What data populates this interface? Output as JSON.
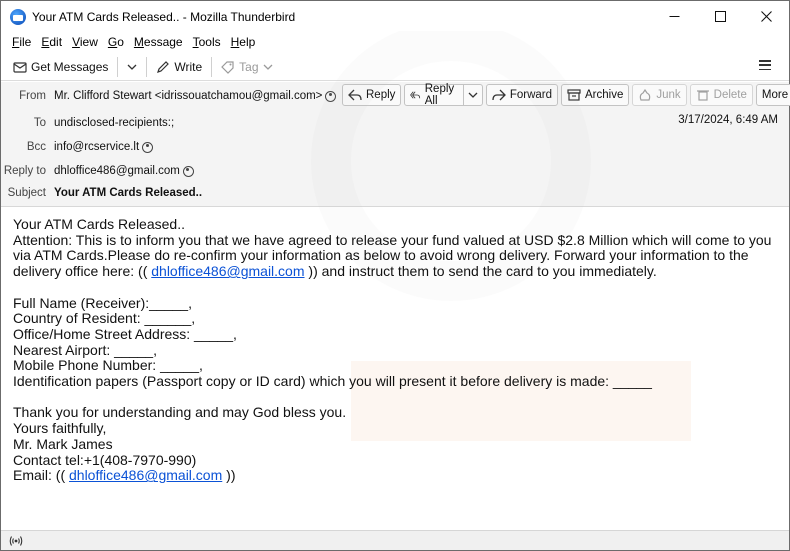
{
  "window": {
    "title": "Your ATM Cards Released.. - Mozilla Thunderbird",
    "controls": [
      "minimize",
      "maximize",
      "close"
    ]
  },
  "menu": [
    "File",
    "Edit",
    "View",
    "Go",
    "Message",
    "Tools",
    "Help"
  ],
  "toolbar": {
    "get_messages": "Get Messages",
    "write": "Write",
    "tag": "Tag"
  },
  "header": {
    "from_label": "From",
    "from_value": "Mr. Clifford Stewart <idrissouatchamou@gmail.com>",
    "to_label": "To",
    "to_value": "undisclosed-recipients:;",
    "bcc_label": "Bcc",
    "bcc_value": "info@rcservice.lt",
    "reply_to_label": "Reply to",
    "reply_to_value": "dhloffice486@gmail.com",
    "subject_label": "Subject",
    "subject_value": "Your ATM Cards Released..",
    "date": "3/17/2024, 6:49 AM",
    "actions": {
      "reply": "Reply",
      "reply_all": "Reply All",
      "forward": "Forward",
      "archive": "Archive",
      "junk": "Junk",
      "delete": "Delete",
      "more": "More"
    }
  },
  "body": {
    "subject": "Your ATM Cards Released..",
    "p1_line1": "Attention: This is to inform you that we have agreed to release your fund valued at USD $2.8 Million which will come to you",
    "p1_line2": "via ATM Cards.Please do re-confirm your information as below to avoid wrong delivery. Forward your information to the",
    "p1_line3_pre": "delivery office here: (( ",
    "p1_link": "dhloffice486@gmail.com",
    "p1_line3_post": "  )) and instruct them to send the card to you immediately.",
    "fields": [
      "Full Name (Receiver):_____,",
      "Country of Resident: ______,",
      "Office/Home Street Address: _____,",
      "Nearest Airport: _____,",
      "Mobile Phone Number: _____,",
      "Identification papers (Passport copy or ID card) which you will present it before delivery is made: _____"
    ],
    "closing": [
      "Thank you for understanding and may God bless you.",
      "Yours faithfully,",
      "Mr. Mark James",
      "Contact tel:+1(408-7970-990)"
    ],
    "email_pre": "Email: (( ",
    "email_link": "dhloffice486@gmail.com",
    "email_post": " ))"
  }
}
